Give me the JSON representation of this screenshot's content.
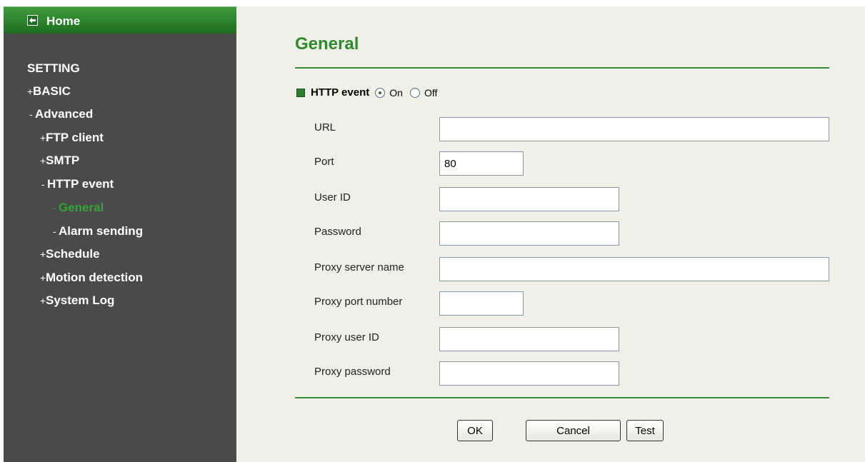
{
  "sidebar": {
    "home_label": "Home",
    "heading": "SETTING",
    "items": [
      {
        "sign": "+",
        "label": "BASIC"
      },
      {
        "sign": "-",
        "label": "Advanced"
      },
      {
        "sign": "+",
        "label": "FTP client"
      },
      {
        "sign": "+",
        "label": "SMTP"
      },
      {
        "sign": "-",
        "label": "HTTP event"
      },
      {
        "sign": "-",
        "label": "General"
      },
      {
        "sign": "-",
        "label": "Alarm sending"
      },
      {
        "sign": "+",
        "label": "Schedule"
      },
      {
        "sign": "+",
        "label": "Motion detection"
      },
      {
        "sign": "+",
        "label": "System Log"
      }
    ],
    "active_item": "General",
    "colors": {
      "background": "#4a4a4a",
      "home_bar": "#2f872f",
      "active": "#34a534"
    }
  },
  "main": {
    "title": "General",
    "section": {
      "label": "HTTP event",
      "options": [
        "On",
        "Off"
      ],
      "selected": "On"
    },
    "fields": [
      {
        "label": "URL",
        "value": ""
      },
      {
        "label": "Port",
        "value": "80"
      },
      {
        "label": "User ID",
        "value": ""
      },
      {
        "label": "Password",
        "value": ""
      },
      {
        "label": "Proxy server name",
        "value": ""
      },
      {
        "label": "Proxy port number",
        "value": ""
      },
      {
        "label": "Proxy user ID",
        "value": ""
      },
      {
        "label": "Proxy password",
        "value": ""
      }
    ],
    "buttons": {
      "ok": "OK",
      "cancel": "Cancel",
      "test": "Test"
    },
    "colors": {
      "accent": "#2e8b2e",
      "panel_bg": "#f0f0e8"
    }
  }
}
